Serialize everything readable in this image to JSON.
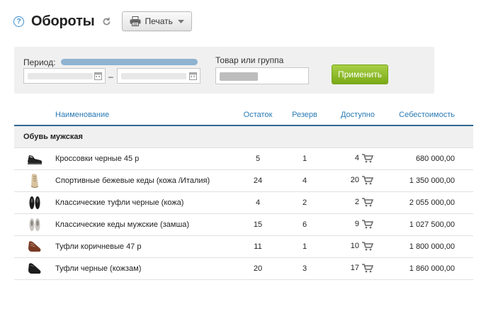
{
  "header": {
    "title": "Обороты",
    "print_label": "Печать"
  },
  "filters": {
    "period_label": "Период:",
    "product_label": "Товар или группа",
    "apply_label": "Применить"
  },
  "table": {
    "columns": [
      "Наименование",
      "Остаток",
      "Резерв",
      "Доступно",
      "Себестоимость"
    ],
    "group": "Обувь мужская",
    "rows": [
      {
        "name": "Кроссовки черные 45 р",
        "stock": "5",
        "reserve": "1",
        "available": "4",
        "cost": "680 000,00"
      },
      {
        "name": "Спортивные бежевые кеды (кожа /Италия)",
        "stock": "24",
        "reserve": "4",
        "available": "20",
        "cost": "1 350 000,00"
      },
      {
        "name": "Классические туфли черные (кожа)",
        "stock": "4",
        "reserve": "2",
        "available": "2",
        "cost": "2 055 000,00"
      },
      {
        "name": "Классические кеды мужские (замша)",
        "stock": "15",
        "reserve": "6",
        "available": "9",
        "cost": "1 027 500,00"
      },
      {
        "name": "Туфли коричневые 47 р",
        "stock": "11",
        "reserve": "1",
        "available": "10",
        "cost": "1 800 000,00"
      },
      {
        "name": "Туфли черные (кожзам)",
        "stock": "20",
        "reserve": "3",
        "available": "17",
        "cost": "1 860 000,00"
      }
    ]
  },
  "colors": {
    "accent": "#2a7ab4",
    "apply": "#8bbc24",
    "period_bar": "#8fb3d1"
  }
}
